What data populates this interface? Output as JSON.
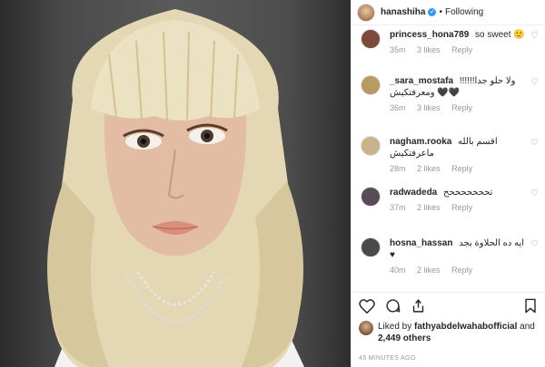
{
  "header": {
    "username": "hanashiha",
    "verified_mark": "✓",
    "separator": "•",
    "follow_label": "Following"
  },
  "comments": [
    {
      "user": "princess_hona789",
      "text": "so sweet 🙂",
      "time": "35m",
      "likes": "3 likes",
      "reply": "Reply",
      "avatar_color": "#7a4a3a"
    },
    {
      "user": "_sara_mostafa",
      "text": "ولا حلو جدا!!!!!! 🖤🖤 ومعرفتكيش",
      "time": "36m",
      "likes": "3 likes",
      "reply": "Reply",
      "avatar_color": "#b89a63"
    },
    {
      "user": "nagham.rooka",
      "text": "اقسم بالله ماعرفتكيش",
      "time": "28m",
      "likes": "2 likes",
      "reply": "Reply",
      "avatar_color": "#c9b38c"
    },
    {
      "user": "radwadeda",
      "text": "تحححححححح",
      "time": "37m",
      "likes": "2 likes",
      "reply": "Reply",
      "avatar_color": "#5a4a5a"
    },
    {
      "user": "hosna_hassan",
      "text": "ايه ده الحلاوة بجد ♥",
      "time": "40m",
      "likes": "2 likes",
      "reply": "Reply",
      "avatar_color": "#4a4a4a"
    }
  ],
  "likes": {
    "prefix": "Liked by",
    "user": "fathyabdelwahabofficial",
    "conjunction": "and",
    "others": "2,449 others"
  },
  "timestamp": "45 MINUTES AGO",
  "icons": {
    "heart": "heart-icon",
    "comment": "comment-icon",
    "share": "share-icon",
    "save": "bookmark-icon"
  }
}
